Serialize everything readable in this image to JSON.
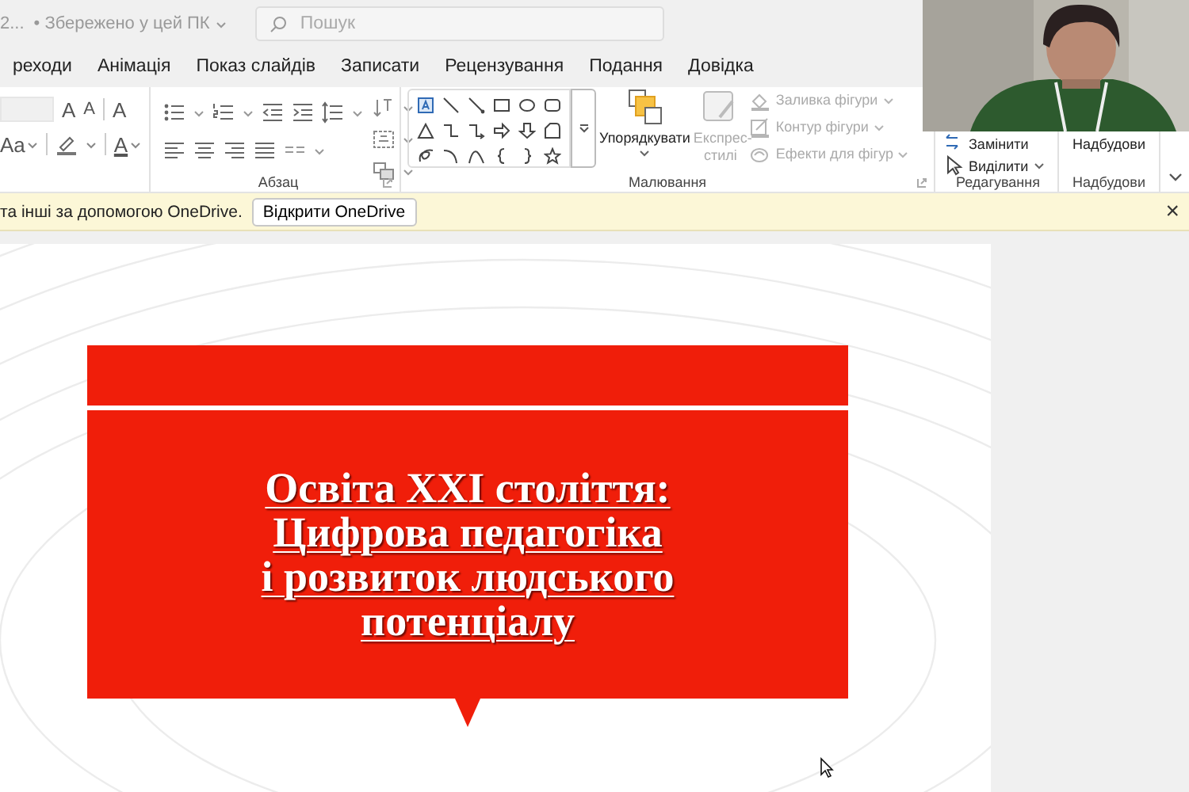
{
  "title_bar": {
    "file_name": "2...",
    "save_status": "• Збережено у цей ПК",
    "search": {
      "placeholder": "Пошук"
    }
  },
  "tabs": [
    {
      "label": "реходи",
      "selected": false
    },
    {
      "label": "Анімація",
      "selected": false
    },
    {
      "label": "Показ слайдів",
      "selected": false
    },
    {
      "label": "Записати",
      "selected": false
    },
    {
      "label": "Рецензування",
      "selected": false
    },
    {
      "label": "Подання",
      "selected": false
    },
    {
      "label": "Довідка",
      "selected": false
    }
  ],
  "ribbon": {
    "font": {
      "tools": [
        {
          "kind": "grow",
          "glyph": "A"
        },
        {
          "kind": "shrink",
          "glyph": "A"
        },
        {
          "kind": "clear",
          "glyph": "A"
        },
        {
          "kind": "case",
          "glyph": "Aa"
        },
        {
          "kind": "highlight"
        },
        {
          "kind": "color",
          "glyph": "A"
        }
      ]
    },
    "paragraph": {
      "label": "Абзац"
    },
    "drawing": {
      "label": "Малювання",
      "arrange": "Упорядкувати",
      "quick_styles": {
        "label": "Експрес-стилі",
        "disabled": true
      },
      "format": [
        {
          "kind": "fill",
          "label": "Заливка фігури",
          "disabled": true
        },
        {
          "kind": "outline",
          "label": "Контур фігури",
          "disabled": true
        },
        {
          "kind": "effects",
          "label": "Ефекти для фігур",
          "disabled": true
        }
      ]
    },
    "editing": {
      "label": "Редагування",
      "items": [
        {
          "kind": "replace",
          "label": "Замінити"
        },
        {
          "kind": "select",
          "label": "Виділити"
        }
      ]
    },
    "addins": {
      "label": "Надбудови",
      "button": "Надбудови"
    }
  },
  "notice": {
    "message": "та інші за допомогою OneDrive.",
    "button": "Відкрити OneDrive",
    "close": "×"
  },
  "slide": {
    "title_lines": [
      "Освіта XXI століття:",
      "Цифрова педагогіка",
      "і розвиток людського",
      "потенціалу"
    ]
  }
}
